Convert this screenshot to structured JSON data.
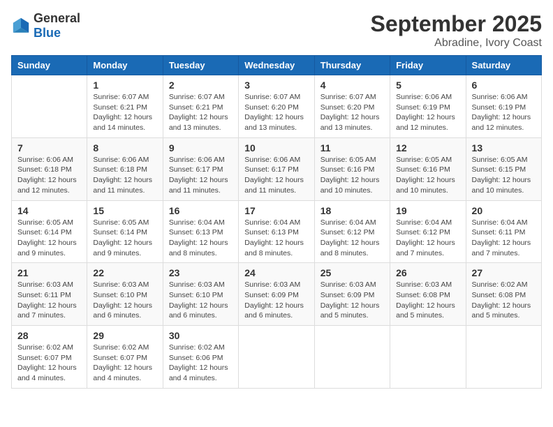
{
  "header": {
    "logo": {
      "general": "General",
      "blue": "Blue"
    },
    "month": "September 2025",
    "location": "Abradine, Ivory Coast"
  },
  "weekdays": [
    "Sunday",
    "Monday",
    "Tuesday",
    "Wednesday",
    "Thursday",
    "Friday",
    "Saturday"
  ],
  "weeks": [
    [
      {
        "day": "",
        "sunrise": "",
        "sunset": "",
        "daylight": ""
      },
      {
        "day": "1",
        "sunrise": "Sunrise: 6:07 AM",
        "sunset": "Sunset: 6:21 PM",
        "daylight": "Daylight: 12 hours and 14 minutes."
      },
      {
        "day": "2",
        "sunrise": "Sunrise: 6:07 AM",
        "sunset": "Sunset: 6:21 PM",
        "daylight": "Daylight: 12 hours and 13 minutes."
      },
      {
        "day": "3",
        "sunrise": "Sunrise: 6:07 AM",
        "sunset": "Sunset: 6:20 PM",
        "daylight": "Daylight: 12 hours and 13 minutes."
      },
      {
        "day": "4",
        "sunrise": "Sunrise: 6:07 AM",
        "sunset": "Sunset: 6:20 PM",
        "daylight": "Daylight: 12 hours and 13 minutes."
      },
      {
        "day": "5",
        "sunrise": "Sunrise: 6:06 AM",
        "sunset": "Sunset: 6:19 PM",
        "daylight": "Daylight: 12 hours and 12 minutes."
      },
      {
        "day": "6",
        "sunrise": "Sunrise: 6:06 AM",
        "sunset": "Sunset: 6:19 PM",
        "daylight": "Daylight: 12 hours and 12 minutes."
      }
    ],
    [
      {
        "day": "7",
        "sunrise": "Sunrise: 6:06 AM",
        "sunset": "Sunset: 6:18 PM",
        "daylight": "Daylight: 12 hours and 12 minutes."
      },
      {
        "day": "8",
        "sunrise": "Sunrise: 6:06 AM",
        "sunset": "Sunset: 6:18 PM",
        "daylight": "Daylight: 12 hours and 11 minutes."
      },
      {
        "day": "9",
        "sunrise": "Sunrise: 6:06 AM",
        "sunset": "Sunset: 6:17 PM",
        "daylight": "Daylight: 12 hours and 11 minutes."
      },
      {
        "day": "10",
        "sunrise": "Sunrise: 6:06 AM",
        "sunset": "Sunset: 6:17 PM",
        "daylight": "Daylight: 12 hours and 11 minutes."
      },
      {
        "day": "11",
        "sunrise": "Sunrise: 6:05 AM",
        "sunset": "Sunset: 6:16 PM",
        "daylight": "Daylight: 12 hours and 10 minutes."
      },
      {
        "day": "12",
        "sunrise": "Sunrise: 6:05 AM",
        "sunset": "Sunset: 6:16 PM",
        "daylight": "Daylight: 12 hours and 10 minutes."
      },
      {
        "day": "13",
        "sunrise": "Sunrise: 6:05 AM",
        "sunset": "Sunset: 6:15 PM",
        "daylight": "Daylight: 12 hours and 10 minutes."
      }
    ],
    [
      {
        "day": "14",
        "sunrise": "Sunrise: 6:05 AM",
        "sunset": "Sunset: 6:14 PM",
        "daylight": "Daylight: 12 hours and 9 minutes."
      },
      {
        "day": "15",
        "sunrise": "Sunrise: 6:05 AM",
        "sunset": "Sunset: 6:14 PM",
        "daylight": "Daylight: 12 hours and 9 minutes."
      },
      {
        "day": "16",
        "sunrise": "Sunrise: 6:04 AM",
        "sunset": "Sunset: 6:13 PM",
        "daylight": "Daylight: 12 hours and 8 minutes."
      },
      {
        "day": "17",
        "sunrise": "Sunrise: 6:04 AM",
        "sunset": "Sunset: 6:13 PM",
        "daylight": "Daylight: 12 hours and 8 minutes."
      },
      {
        "day": "18",
        "sunrise": "Sunrise: 6:04 AM",
        "sunset": "Sunset: 6:12 PM",
        "daylight": "Daylight: 12 hours and 8 minutes."
      },
      {
        "day": "19",
        "sunrise": "Sunrise: 6:04 AM",
        "sunset": "Sunset: 6:12 PM",
        "daylight": "Daylight: 12 hours and 7 minutes."
      },
      {
        "day": "20",
        "sunrise": "Sunrise: 6:04 AM",
        "sunset": "Sunset: 6:11 PM",
        "daylight": "Daylight: 12 hours and 7 minutes."
      }
    ],
    [
      {
        "day": "21",
        "sunrise": "Sunrise: 6:03 AM",
        "sunset": "Sunset: 6:11 PM",
        "daylight": "Daylight: 12 hours and 7 minutes."
      },
      {
        "day": "22",
        "sunrise": "Sunrise: 6:03 AM",
        "sunset": "Sunset: 6:10 PM",
        "daylight": "Daylight: 12 hours and 6 minutes."
      },
      {
        "day": "23",
        "sunrise": "Sunrise: 6:03 AM",
        "sunset": "Sunset: 6:10 PM",
        "daylight": "Daylight: 12 hours and 6 minutes."
      },
      {
        "day": "24",
        "sunrise": "Sunrise: 6:03 AM",
        "sunset": "Sunset: 6:09 PM",
        "daylight": "Daylight: 12 hours and 6 minutes."
      },
      {
        "day": "25",
        "sunrise": "Sunrise: 6:03 AM",
        "sunset": "Sunset: 6:09 PM",
        "daylight": "Daylight: 12 hours and 5 minutes."
      },
      {
        "day": "26",
        "sunrise": "Sunrise: 6:03 AM",
        "sunset": "Sunset: 6:08 PM",
        "daylight": "Daylight: 12 hours and 5 minutes."
      },
      {
        "day": "27",
        "sunrise": "Sunrise: 6:02 AM",
        "sunset": "Sunset: 6:08 PM",
        "daylight": "Daylight: 12 hours and 5 minutes."
      }
    ],
    [
      {
        "day": "28",
        "sunrise": "Sunrise: 6:02 AM",
        "sunset": "Sunset: 6:07 PM",
        "daylight": "Daylight: 12 hours and 4 minutes."
      },
      {
        "day": "29",
        "sunrise": "Sunrise: 6:02 AM",
        "sunset": "Sunset: 6:07 PM",
        "daylight": "Daylight: 12 hours and 4 minutes."
      },
      {
        "day": "30",
        "sunrise": "Sunrise: 6:02 AM",
        "sunset": "Sunset: 6:06 PM",
        "daylight": "Daylight: 12 hours and 4 minutes."
      },
      {
        "day": "",
        "sunrise": "",
        "sunset": "",
        "daylight": ""
      },
      {
        "day": "",
        "sunrise": "",
        "sunset": "",
        "daylight": ""
      },
      {
        "day": "",
        "sunrise": "",
        "sunset": "",
        "daylight": ""
      },
      {
        "day": "",
        "sunrise": "",
        "sunset": "",
        "daylight": ""
      }
    ]
  ]
}
